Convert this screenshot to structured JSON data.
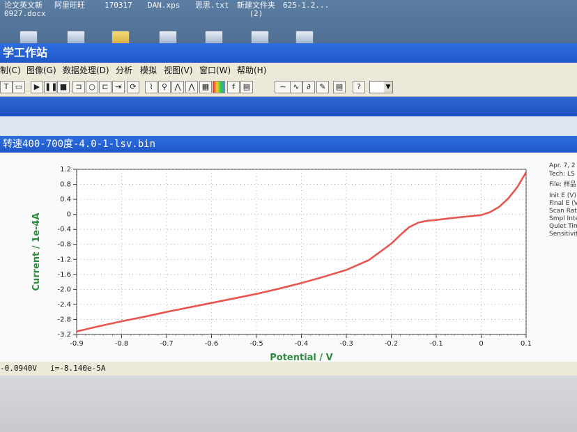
{
  "desktop": {
    "icons": [
      {
        "label": "论文英文新\n0927.docx",
        "icon": "word-doc-icon"
      },
      {
        "label": "阿里旺旺",
        "icon": "aliwangwang-icon"
      },
      {
        "label": "170317",
        "icon": "folder-icon"
      },
      {
        "label": "DAN.xps",
        "icon": "xps-file-icon"
      },
      {
        "label": "思思.txt",
        "icon": "text-file-icon"
      },
      {
        "label": "新建文件夹\n(2)",
        "icon": "folder-icon"
      },
      {
        "label": "625-1.2...",
        "icon": "file-icon"
      }
    ]
  },
  "window": {
    "title": "学工作站"
  },
  "menu": [
    "制(C)",
    "图像(G)",
    "数据处理(D)",
    "分析",
    "模拟",
    "视图(V)",
    "窗口(W)",
    "帮助(H)"
  ],
  "document": {
    "title": "转速400-700度-4.0-1-lsv.bin"
  },
  "side_info": {
    "lines": [
      "Apr. 7, 2",
      "Tech: LS",
      "File: 样品",
      "Init E (V)",
      "Final E (V",
      "Scan Rat",
      "Smpl Inter",
      "Quiet Time",
      "Sensitivity"
    ]
  },
  "status": {
    "potential": "-0.0940V",
    "current": "i=-8.140e-5A"
  },
  "colors": {
    "curve": "#e8574f",
    "axis_label": "#2e8b3d",
    "title_bar": "#2f6ee0"
  },
  "chart_data": {
    "type": "line",
    "xlabel": "Potential / V",
    "ylabel": "Current / 1e-4A",
    "xlim": [
      -0.9,
      0.1
    ],
    "ylim": [
      -3.2,
      1.2
    ],
    "x_ticks": [
      "-0.9",
      "-0.8",
      "-0.7",
      "-0.6",
      "-0.5",
      "-0.4",
      "-0.3",
      "-0.2",
      "-0.1",
      "0",
      "0.1"
    ],
    "y_ticks": [
      "1.2",
      "0.8",
      "0.4",
      "0",
      "-0.4",
      "-0.8",
      "-1.2",
      "-1.6",
      "-2.0",
      "-2.4",
      "-2.8",
      "-3.2"
    ],
    "grid": true,
    "series": [
      {
        "x": [
          -0.9,
          -0.85,
          -0.8,
          -0.75,
          -0.7,
          -0.65,
          -0.6,
          -0.55,
          -0.5,
          -0.45,
          -0.4,
          -0.35,
          -0.3,
          -0.25,
          -0.2,
          -0.18,
          -0.16,
          -0.14,
          -0.12,
          -0.1,
          -0.08,
          -0.05,
          0.0,
          0.02,
          0.04,
          0.06,
          0.08,
          0.1
        ],
        "y": [
          -3.12,
          -2.98,
          -2.85,
          -2.73,
          -2.6,
          -2.48,
          -2.36,
          -2.24,
          -2.12,
          -1.98,
          -1.83,
          -1.66,
          -1.48,
          -1.22,
          -0.78,
          -0.55,
          -0.34,
          -0.22,
          -0.17,
          -0.15,
          -0.12,
          -0.08,
          -0.02,
          0.06,
          0.2,
          0.42,
          0.72,
          1.12
        ]
      }
    ]
  }
}
